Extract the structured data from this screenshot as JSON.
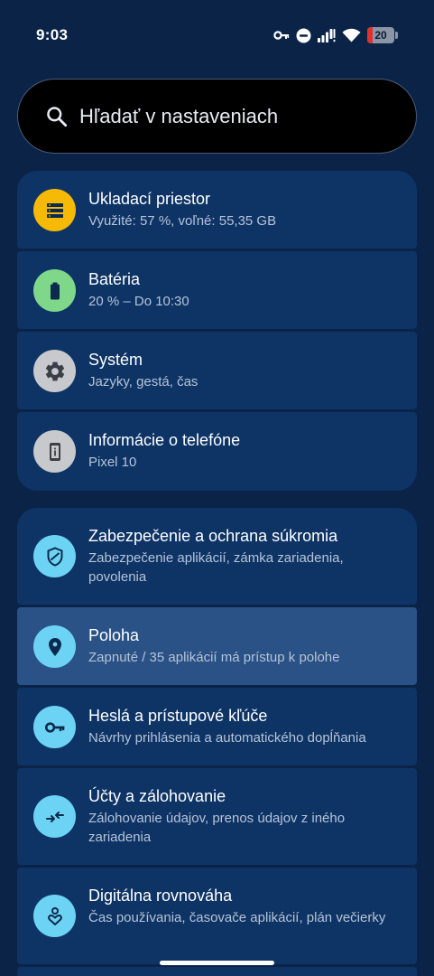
{
  "status_bar": {
    "time": "9:03",
    "battery_level": "20",
    "icons": [
      "vpn-key-icon",
      "do-not-disturb-icon",
      "signal-icon",
      "wifi-icon",
      "battery-icon"
    ]
  },
  "search": {
    "placeholder": "Hľadať v nastaveniach"
  },
  "group1": {
    "items": [
      {
        "title": "Ukladací priestor",
        "subtitle": "Využité: 57 %, voľné: 55,35 GB",
        "icon": "storage-icon",
        "icon_bg": "#f6b905"
      },
      {
        "title": "Batéria",
        "subtitle": "20 % – Do 10:30",
        "icon": "battery-icon",
        "icon_bg": "#7fd88a"
      },
      {
        "title": "Systém",
        "subtitle": "Jazyky, gestá, čas",
        "icon": "gear-icon",
        "icon_bg": "#c7c9cc"
      },
      {
        "title": "Informácie o telefóne",
        "subtitle": "Pixel 10",
        "icon": "phone-info-icon",
        "icon_bg": "#c7c9cc"
      }
    ]
  },
  "group2": {
    "items": [
      {
        "title": "Zabezpečenie a ochrana súkromia",
        "subtitle": "Zabezpečenie aplikácií, zámka zariadenia, povolenia",
        "icon": "shield-icon",
        "icon_bg": "#6dd3f5"
      },
      {
        "title": "Poloha",
        "subtitle": "Zapnuté / 35 aplikácií má prístup k polohe",
        "icon": "location-pin-icon",
        "icon_bg": "#6dd3f5",
        "selected": true
      },
      {
        "title": "Heslá a prístupové kľúče",
        "subtitle": "Návrhy prihlásenia a automatického dopĺňania",
        "icon": "key-icon",
        "icon_bg": "#6dd3f5"
      },
      {
        "title": "Účty a zálohovanie",
        "subtitle": "Zálohovanie údajov, prenos údajov z iného zariadenia",
        "icon": "transfer-arrows-icon",
        "icon_bg": "#6dd3f5"
      },
      {
        "title": "Digitálna rovnováha",
        "subtitle": "Čas používania, časovače aplikácií, plán večierky",
        "icon": "wellbeing-icon",
        "icon_bg": "#6dd3f5"
      }
    ]
  },
  "colors": {
    "background": "#0a2347",
    "card": "#0e3466",
    "card_selected": "#2a5286",
    "icon_dark": "#0b2a4d",
    "battery_critical": "#e0312f"
  }
}
